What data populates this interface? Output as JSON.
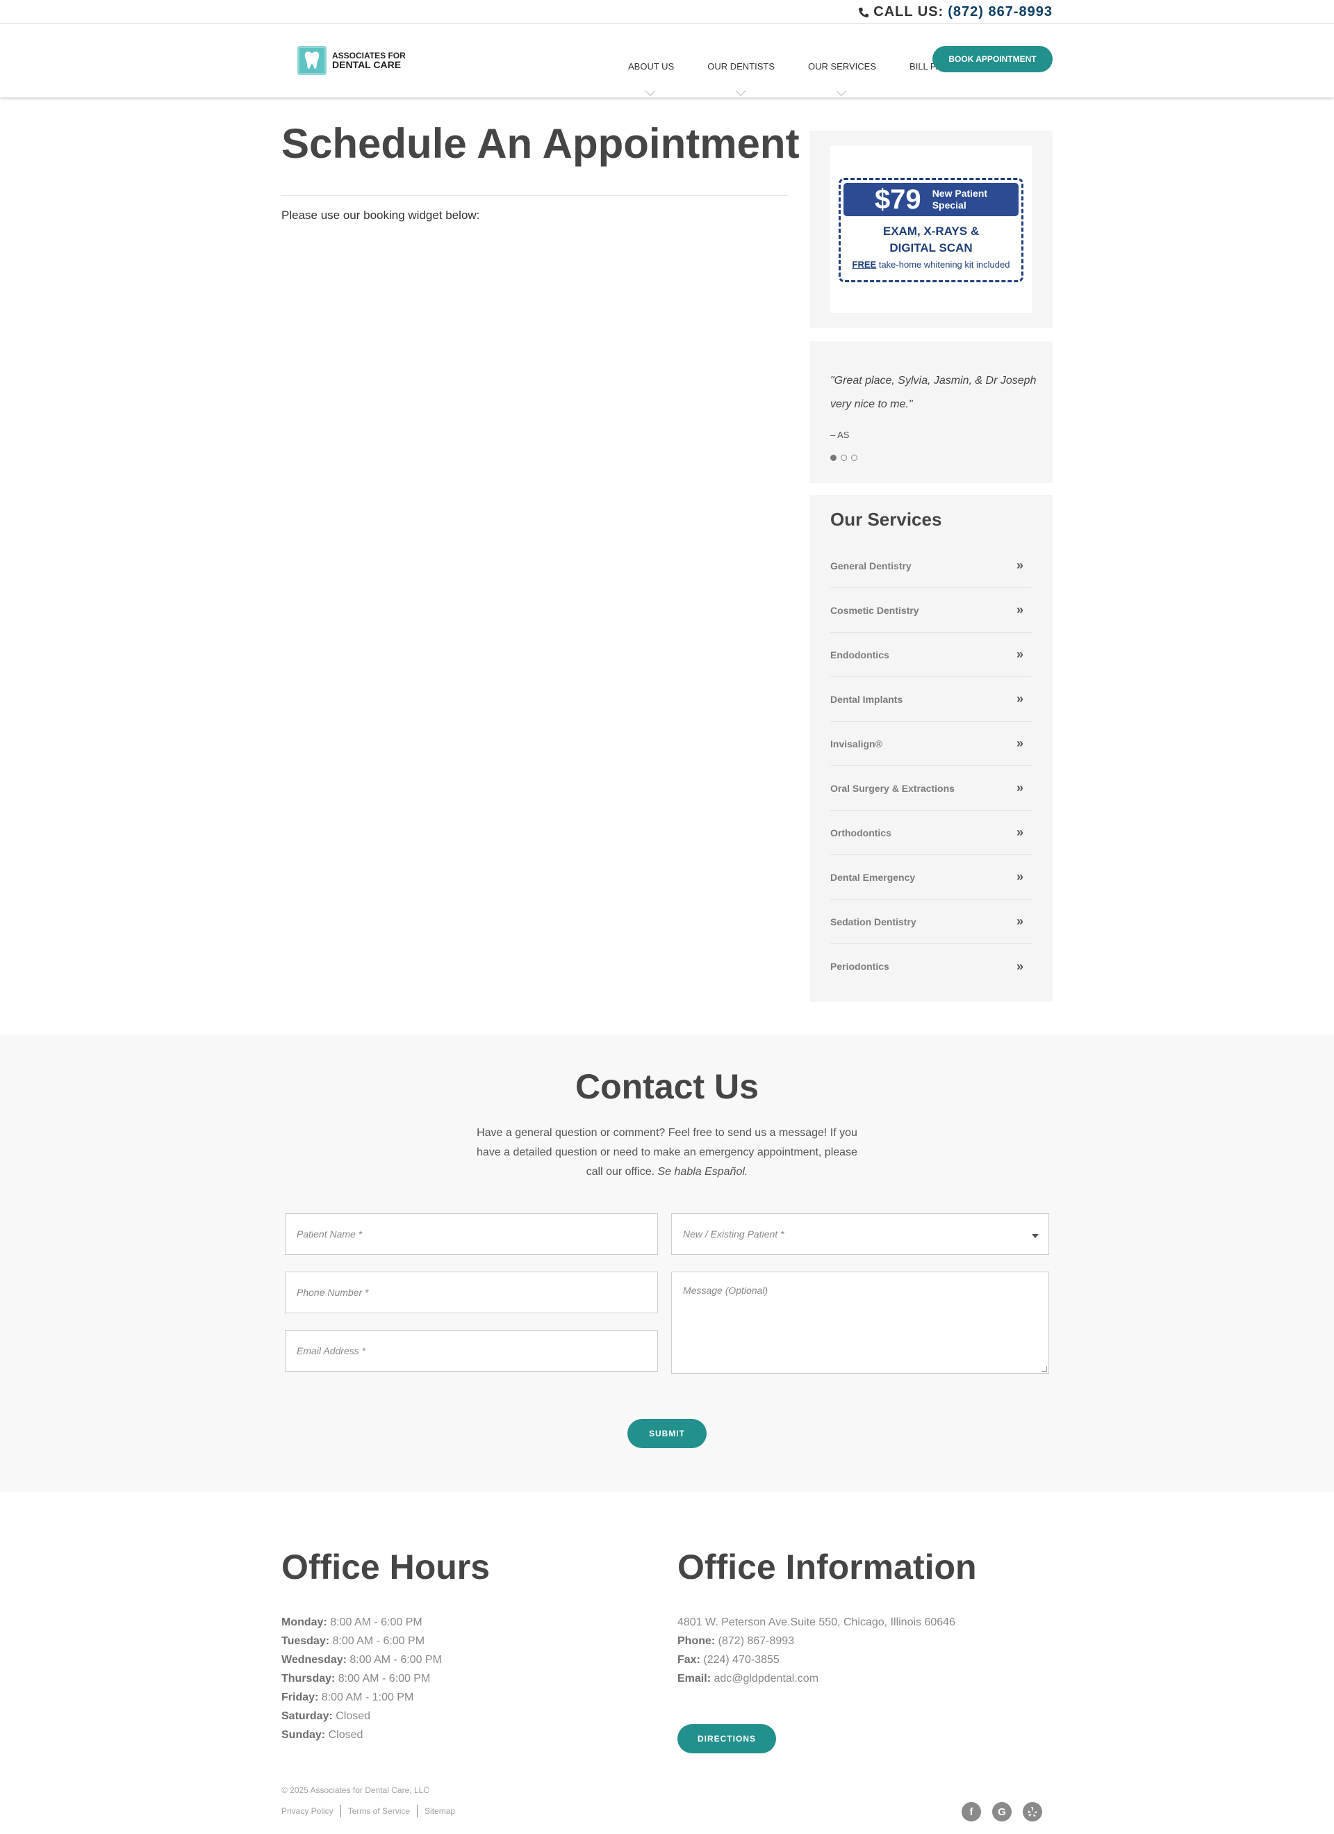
{
  "topbar": {
    "call_label": "CALL US:",
    "phone": "(872) 867-8993"
  },
  "header": {
    "logo_line1": "ASSOCIATES FOR",
    "logo_line2": "DENTAL CARE",
    "nav": [
      "ABOUT US",
      "OUR DENTISTS",
      "OUR SERVICES",
      "BILL PAY"
    ],
    "book_label": "BOOK APPOINTMENT"
  },
  "main": {
    "title": "Schedule An Appointment",
    "intro": "Please use our booking widget below:"
  },
  "promo": {
    "price": "$79",
    "sub_line1": "New Patient",
    "sub_line2": "Special",
    "exam_line1": "EXAM, X-RAYS &",
    "exam_line2": "DIGITAL SCAN",
    "free_word": "FREE",
    "free_rest": " take-home whitening kit included"
  },
  "testimonial": {
    "quote": "\"Great place, Sylvia, Jasmin, & Dr Joseph very nice to me.\"",
    "author": "– AS"
  },
  "services": {
    "title": "Our Services",
    "items": [
      "General Dentistry",
      "Cosmetic Dentistry",
      "Endodontics",
      "Dental Implants",
      "Invisalign®",
      "Oral Surgery & Extractions",
      "Orthodontics",
      "Dental Emergency",
      "Sedation Dentistry",
      "Periodontics"
    ]
  },
  "contact": {
    "title": "Contact Us",
    "text": "Have a general question or comment? Feel free to send us a message! If you have a detailed question or need to make an emergency appointment, please call our office. ",
    "text_em": "Se habla Español.",
    "patient_name_ph": "Patient Name *",
    "patient_type_ph": "New / Existing Patient *",
    "phone_ph": "Phone Number *",
    "message_ph": "Message (Optional)",
    "email_ph": "Email Address *",
    "submit_label": "SUBMIT"
  },
  "hours": {
    "title": "Office Hours",
    "days": [
      {
        "day": "Monday:",
        "time": "8:00 AM - 6:00 PM"
      },
      {
        "day": "Tuesday:",
        "time": "8:00 AM - 6:00 PM"
      },
      {
        "day": "Wednesday:",
        "time": "8:00 AM - 6:00 PM"
      },
      {
        "day": "Thursday:",
        "time": "8:00 AM - 6:00 PM"
      },
      {
        "day": "Friday:",
        "time": "8:00 AM - 1:00 PM"
      },
      {
        "day": "Saturday:",
        "time": "Closed"
      },
      {
        "day": "Sunday:",
        "time": "Closed"
      }
    ]
  },
  "office": {
    "title": "Office Information",
    "address": "4801 W. Peterson Ave.Suite 550, Chicago, Illinois 60646",
    "phone_label": "Phone:",
    "phone": "(872) 867-8993",
    "fax_label": "Fax:",
    "fax": "(224) 470-3855",
    "email_label": "Email:",
    "email": "adc@gldpdental.com",
    "directions_label": "DIRECTIONS"
  },
  "footer": {
    "copyright": "© 2025 Associates for Dental Care, LLC",
    "links": [
      "Privacy Policy",
      "Terms of Service",
      "Sitemap"
    ],
    "social_icons": [
      "facebook-icon",
      "google-icon",
      "yelp-icon"
    ]
  },
  "colors": {
    "accent": "#22908c",
    "heading": "#454545",
    "phone_blue": "#0c3f63",
    "coupon_blue": "#2d4b92"
  }
}
